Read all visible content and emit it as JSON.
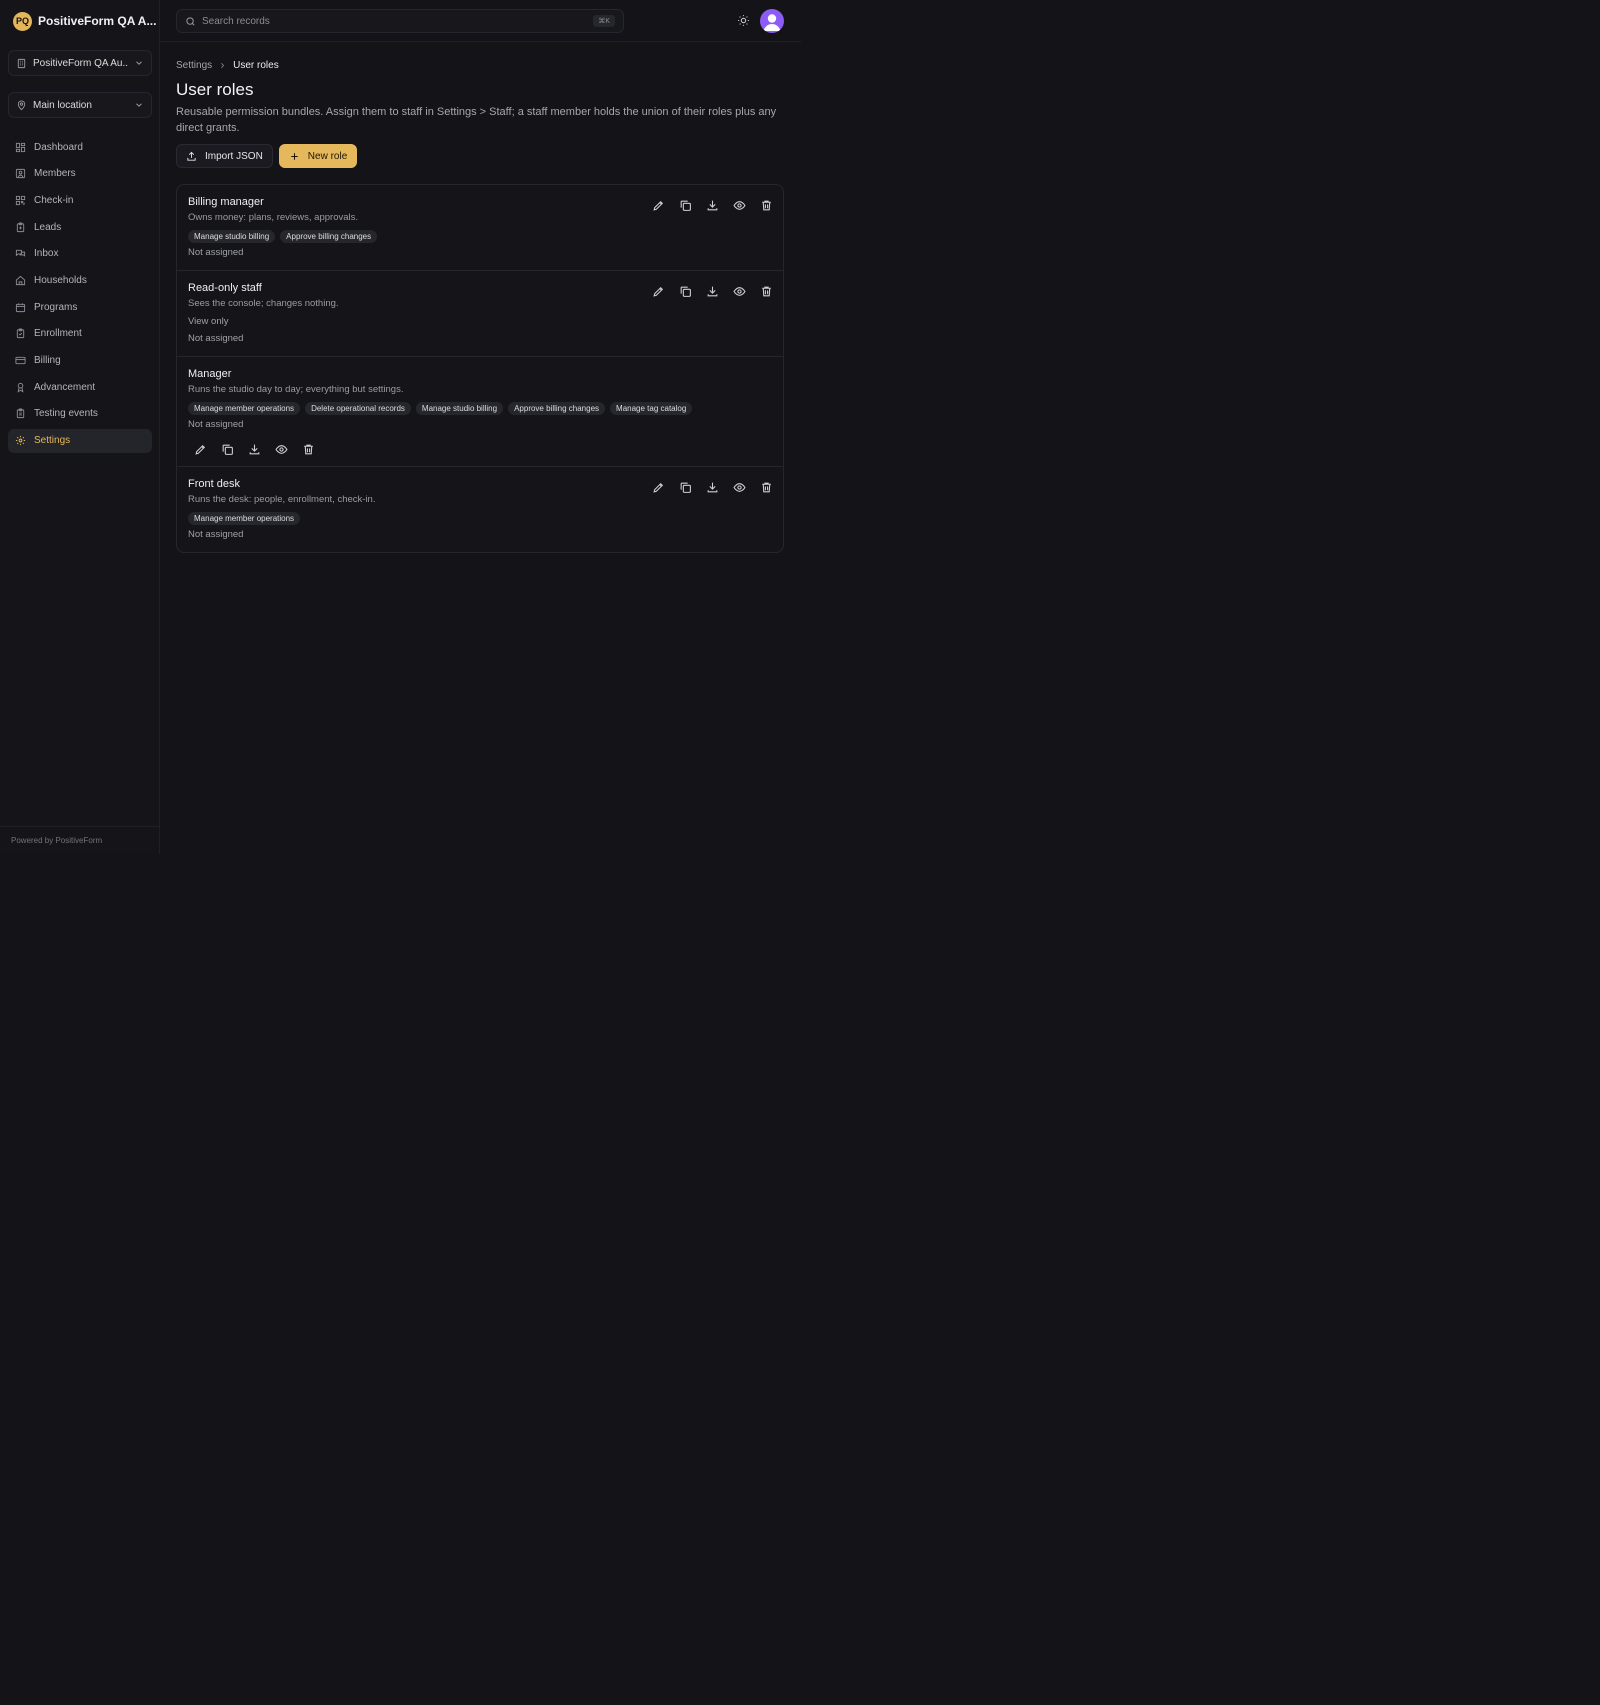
{
  "app": {
    "brand_initials": "PQ",
    "brand_name": "PositiveForm QA A...",
    "accent_color": "#e6b85c"
  },
  "sidebar": {
    "org_selector": "PositiveForm QA Au...",
    "location_selector": "Main location",
    "items": [
      {
        "label": "Dashboard",
        "icon": "dashboard-icon"
      },
      {
        "label": "Members",
        "icon": "members-icon"
      },
      {
        "label": "Check-in",
        "icon": "qr-icon"
      },
      {
        "label": "Leads",
        "icon": "clipboard-icon"
      },
      {
        "label": "Inbox",
        "icon": "chat-icon"
      },
      {
        "label": "Households",
        "icon": "home-icon"
      },
      {
        "label": "Programs",
        "icon": "calendar-icon"
      },
      {
        "label": "Enrollment",
        "icon": "clipboard-check-icon"
      },
      {
        "label": "Billing",
        "icon": "credit-card-icon"
      },
      {
        "label": "Advancement",
        "icon": "award-icon"
      },
      {
        "label": "Testing events",
        "icon": "clipboard-list-icon"
      },
      {
        "label": "Settings",
        "icon": "gear-icon",
        "active": true
      }
    ],
    "footer": "Powered by PositiveForm"
  },
  "header": {
    "search_placeholder": "Search records",
    "search_shortcut": "⌘K"
  },
  "breadcrumb": {
    "parent": "Settings",
    "current": "User roles"
  },
  "page": {
    "title": "User roles",
    "description": "Reusable permission bundles. Assign them to staff in Settings > Staff; a staff member holds the union of their roles plus any direct grants.",
    "import_label": "Import JSON",
    "new_label": "New role"
  },
  "roles": [
    {
      "name": "Billing manager",
      "description": "Owns money: plans, reviews, approvals.",
      "permissions": [
        "Manage studio billing",
        "Approve billing changes"
      ],
      "assignment": "Not assigned"
    },
    {
      "name": "Read-only staff",
      "description": "Sees the console; changes nothing.",
      "permissions_note": "View only",
      "assignment": "Not assigned"
    },
    {
      "name": "Manager",
      "description": "Runs the studio day to day; everything but settings.",
      "permissions": [
        "Manage member operations",
        "Delete operational records",
        "Manage studio billing",
        "Approve billing changes",
        "Manage tag catalog"
      ],
      "assignment": "Not assigned"
    },
    {
      "name": "Front desk",
      "description": "Runs the desk: people, enrollment, check-in.",
      "permissions": [
        "Manage member operations"
      ],
      "assignment": "Not assigned"
    }
  ]
}
